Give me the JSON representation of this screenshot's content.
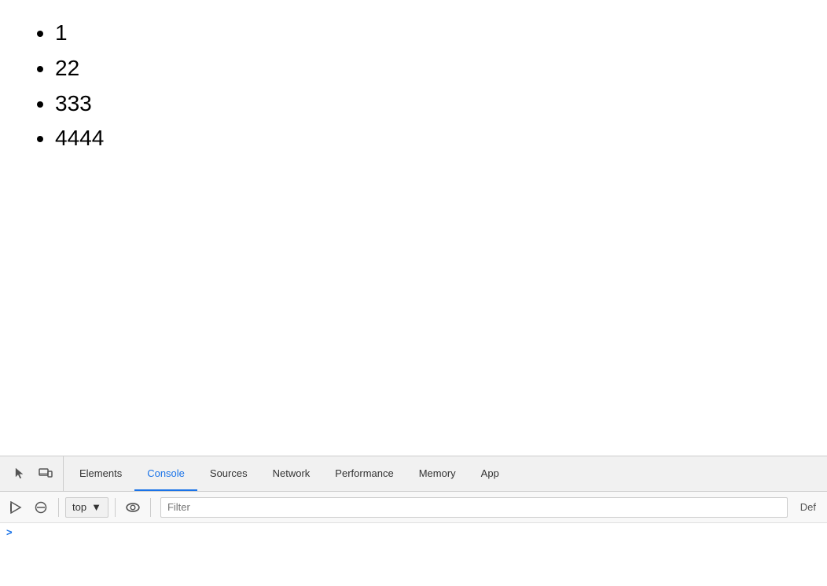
{
  "browser": {
    "content": {
      "list_items": [
        "1",
        "22",
        "333",
        "4444"
      ]
    }
  },
  "devtools": {
    "tabs": [
      {
        "id": "elements",
        "label": "Elements",
        "active": false
      },
      {
        "id": "console",
        "label": "Console",
        "active": true
      },
      {
        "id": "sources",
        "label": "Sources",
        "active": false
      },
      {
        "id": "network",
        "label": "Network",
        "active": false
      },
      {
        "id": "performance",
        "label": "Performance",
        "active": false
      },
      {
        "id": "memory",
        "label": "Memory",
        "active": false
      },
      {
        "id": "application",
        "label": "App",
        "active": false
      }
    ],
    "toolbar": {
      "context_value": "top",
      "context_dropdown_icon": "▼",
      "filter_placeholder": "Filter",
      "default_label": "Def"
    },
    "console_area": {
      "prompt_icon": ">"
    }
  }
}
